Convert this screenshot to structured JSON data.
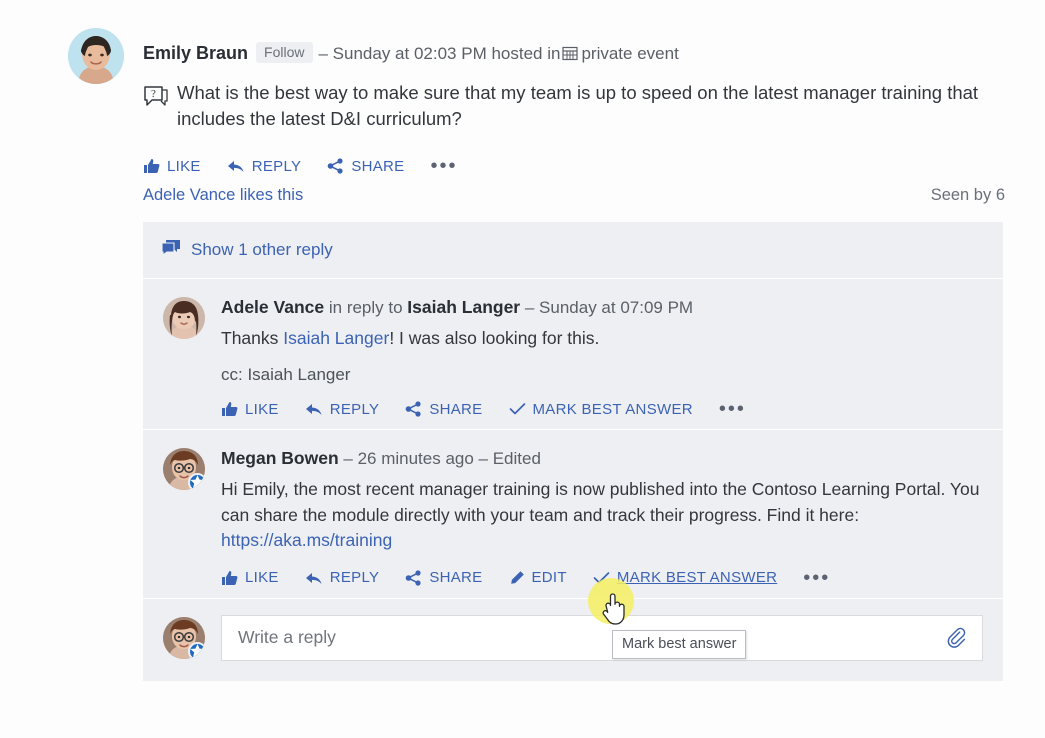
{
  "root_post": {
    "author": "Emily Braun",
    "follow_label": "Follow",
    "meta_prefix": "– Sunday at 02:03 PM hosted in",
    "event_name": "private event",
    "question": "What is the best way to make sure that my team is up to speed on the latest manager training that includes the latest D&I curriculum?",
    "actions": [
      {
        "label": "LIKE",
        "icon": "thumbs-up-icon"
      },
      {
        "label": "REPLY",
        "icon": "reply-arrow-icon"
      },
      {
        "label": "SHARE",
        "icon": "share-icon"
      }
    ],
    "more_label": "•••",
    "likes_text": "Adele Vance likes this",
    "seen_by": "Seen by 6"
  },
  "thread": {
    "show_replies_label": "Show 1 other reply",
    "replies": [
      {
        "author": "Adele Vance",
        "in_reply_to_prefix": "in reply to",
        "in_reply_to": "Isaiah Langer",
        "timestamp": "– Sunday at 07:09 PM",
        "text_before_mention": "Thanks ",
        "mention": "Isaiah Langer",
        "text_after_mention": "! I was also looking for this.",
        "cc_line": "cc: Isaiah Langer",
        "actions": [
          {
            "label": "LIKE",
            "icon": "thumbs-up-icon"
          },
          {
            "label": "REPLY",
            "icon": "reply-arrow-icon"
          },
          {
            "label": "SHARE",
            "icon": "share-icon"
          },
          {
            "label": "MARK BEST ANSWER",
            "icon": "check-icon"
          }
        ],
        "more_label": "•••"
      },
      {
        "author": "Megan Bowen",
        "timestamp": "– 26 minutes ago – Edited",
        "text_before_link": "Hi Emily, the most recent manager training is now published into the Contoso Learning Portal. You can share the module directly with your team and track their progress. Find it here: ",
        "link": "https://aka.ms/training",
        "actions": [
          {
            "label": "LIKE",
            "icon": "thumbs-up-icon"
          },
          {
            "label": "REPLY",
            "icon": "reply-arrow-icon"
          },
          {
            "label": "SHARE",
            "icon": "share-icon"
          },
          {
            "label": "EDIT",
            "icon": "pencil-icon"
          },
          {
            "label": "MARK BEST ANSWER",
            "icon": "check-icon"
          }
        ],
        "more_label": "•••"
      }
    ],
    "composer": {
      "placeholder": "Write a reply",
      "value": "",
      "attach_icon": "paperclip-icon"
    }
  },
  "tooltip": {
    "text": "Mark best answer"
  },
  "colors": {
    "link_blue": "#3c63b3",
    "panel_gray": "#eeeff2",
    "text_dark": "#33373d",
    "meta_gray": "#5b6068",
    "highlight_yellow": "#f5ee61",
    "badge_blue": "#1f6bc4"
  }
}
